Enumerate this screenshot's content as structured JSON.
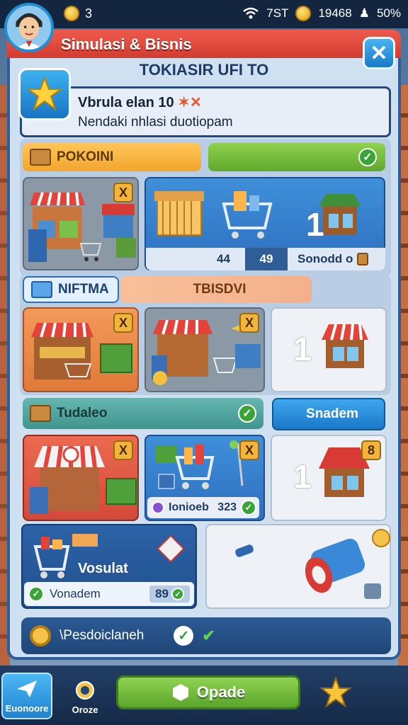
{
  "status_bar": {
    "coins": "3",
    "signal_text": "7ST",
    "gold": "19468",
    "battery": "50%"
  },
  "header": {
    "title": "Simulasi & Bisnis",
    "subtitle": "TOKIASIR UFI TO",
    "close_label": "✕"
  },
  "quest": {
    "title": "Vbrula elan 10",
    "title_mark": "✶✕",
    "description": "Nendaki nhlasi duotiopam"
  },
  "section1": {
    "tag_label": "POKOINI",
    "green_check": "✓",
    "card1_badge": "X",
    "stats": {
      "a": "44",
      "b": "49",
      "c": "Sonodd o"
    },
    "count_label": "1"
  },
  "section2": {
    "tag_label": "NIFTMA",
    "banner_label": "TBISDVI",
    "card1_badge": "X",
    "card2_badge": "X",
    "count_label": "1"
  },
  "section3": {
    "tag_label": "Tudaleo",
    "button_label": "Snadem",
    "card1_badge": "X",
    "card2_badge": "X",
    "card3_badge": "8",
    "info_text": "Ionioeb",
    "info_value": "323",
    "count_label": "1"
  },
  "section4": {
    "card_title": "Vosulat",
    "bar_label": "Vonadem",
    "bar_value": "89"
  },
  "bottom_row": {
    "label": "\\Pesdoiclaneh"
  },
  "footer": {
    "nav1": "Euonoore",
    "nav2": "Oroze",
    "open_label": "Opade"
  },
  "colors": {
    "accent_red": "#d23d31",
    "accent_blue": "#1a79c9",
    "accent_green": "#5fa82d",
    "accent_orange": "#f2a52c"
  }
}
